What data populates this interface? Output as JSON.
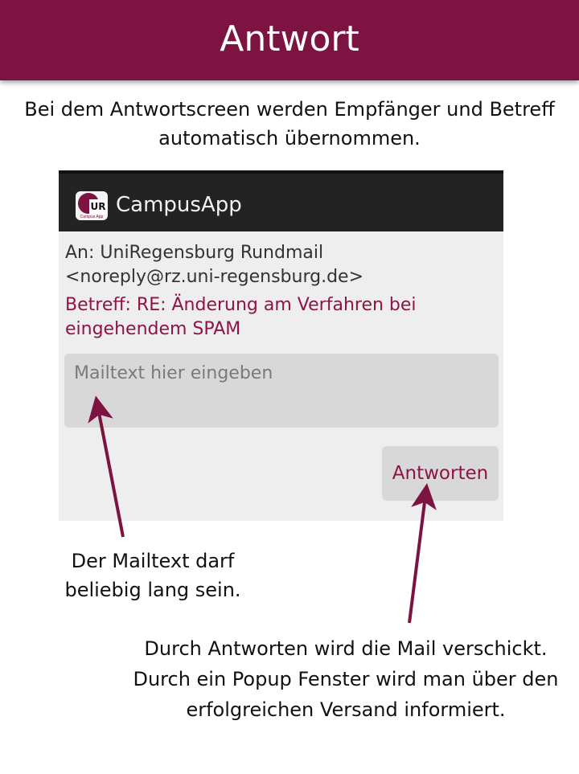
{
  "slide": {
    "title": "Antwort",
    "intro": "Bei dem Antwortscreen werden Empfänger und Betreff automatisch übernommen."
  },
  "app": {
    "name": "CampusApp",
    "icon": "ur-logo-icon",
    "icon_text": "UR",
    "icon_subtext": "Campus App"
  },
  "reply": {
    "to_line1": "An: UniRegensburg Rundmail",
    "to_line2": "<noreply@rz.uni-regensburg.de>",
    "subject": "Betreff: RE: Änderung am Verfahren bei eingehendem SPAM",
    "body_placeholder": "Mailtext hier eingeben",
    "button_label": "Antworten"
  },
  "annotations": {
    "mailtext": "Der Mailtext darf beliebig lang sein.",
    "send": "Durch Antworten wird die Mail verschickt. Durch ein Popup Fenster wird man über den erfolgreichen Versand informiert."
  },
  "colors": {
    "brand": "#7d1340",
    "accent_text": "#8e1447",
    "actionbar": "#232323"
  }
}
